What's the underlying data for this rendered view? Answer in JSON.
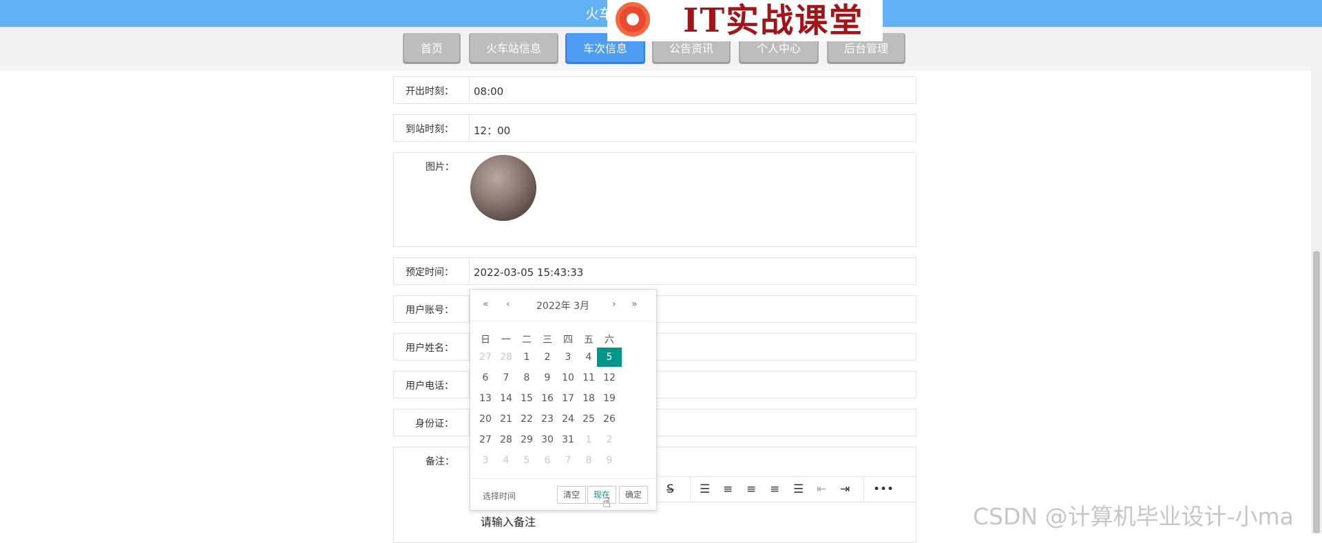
{
  "header": {
    "site_title": "火车",
    "logo_text": "IT实战课堂"
  },
  "nav": [
    {
      "label": "首页"
    },
    {
      "label": "火车站信息"
    },
    {
      "label": "车次信息"
    },
    {
      "label": "公告资讯"
    },
    {
      "label": "个人中心"
    },
    {
      "label": "后台管理"
    }
  ],
  "form": {
    "depart_label": "开出时刻：",
    "depart_value": "08:00",
    "arrive_label": "到站时刻：",
    "arrive_value": "12：00",
    "image_label": "图片：",
    "book_label": "预定时间：",
    "book_value": "2022-03-05 15:43:33",
    "account_label": "用户账号：",
    "name_label": "用户姓名：",
    "phone_label": "用户电话：",
    "id_label": "身份证：",
    "remark_label": "备注：",
    "remark_placeholder": "请输入备注"
  },
  "datepicker": {
    "year_month": "2022年  3月",
    "weekdays": [
      "日",
      "一",
      "二",
      "三",
      "四",
      "五",
      "六"
    ],
    "weeks": [
      [
        "27",
        "28",
        "1",
        "2",
        "3",
        "4",
        "5"
      ],
      [
        "6",
        "7",
        "8",
        "9",
        "10",
        "11",
        "12"
      ],
      [
        "13",
        "14",
        "15",
        "16",
        "17",
        "18",
        "19"
      ],
      [
        "20",
        "21",
        "22",
        "23",
        "24",
        "25",
        "26"
      ],
      [
        "27",
        "28",
        "29",
        "30",
        "31",
        "1",
        "2"
      ],
      [
        "3",
        "4",
        "5",
        "6",
        "7",
        "8",
        "9"
      ]
    ],
    "selected_day": "5",
    "select_time": "选择时间",
    "clear": "清空",
    "now": "现在",
    "confirm": "确定"
  },
  "watermark": "CSDN @计算机毕业设计-小ma",
  "colors": {
    "topbar": "#61b1f7",
    "nav_active": "#4f9cf5",
    "selected_day": "#009688"
  }
}
